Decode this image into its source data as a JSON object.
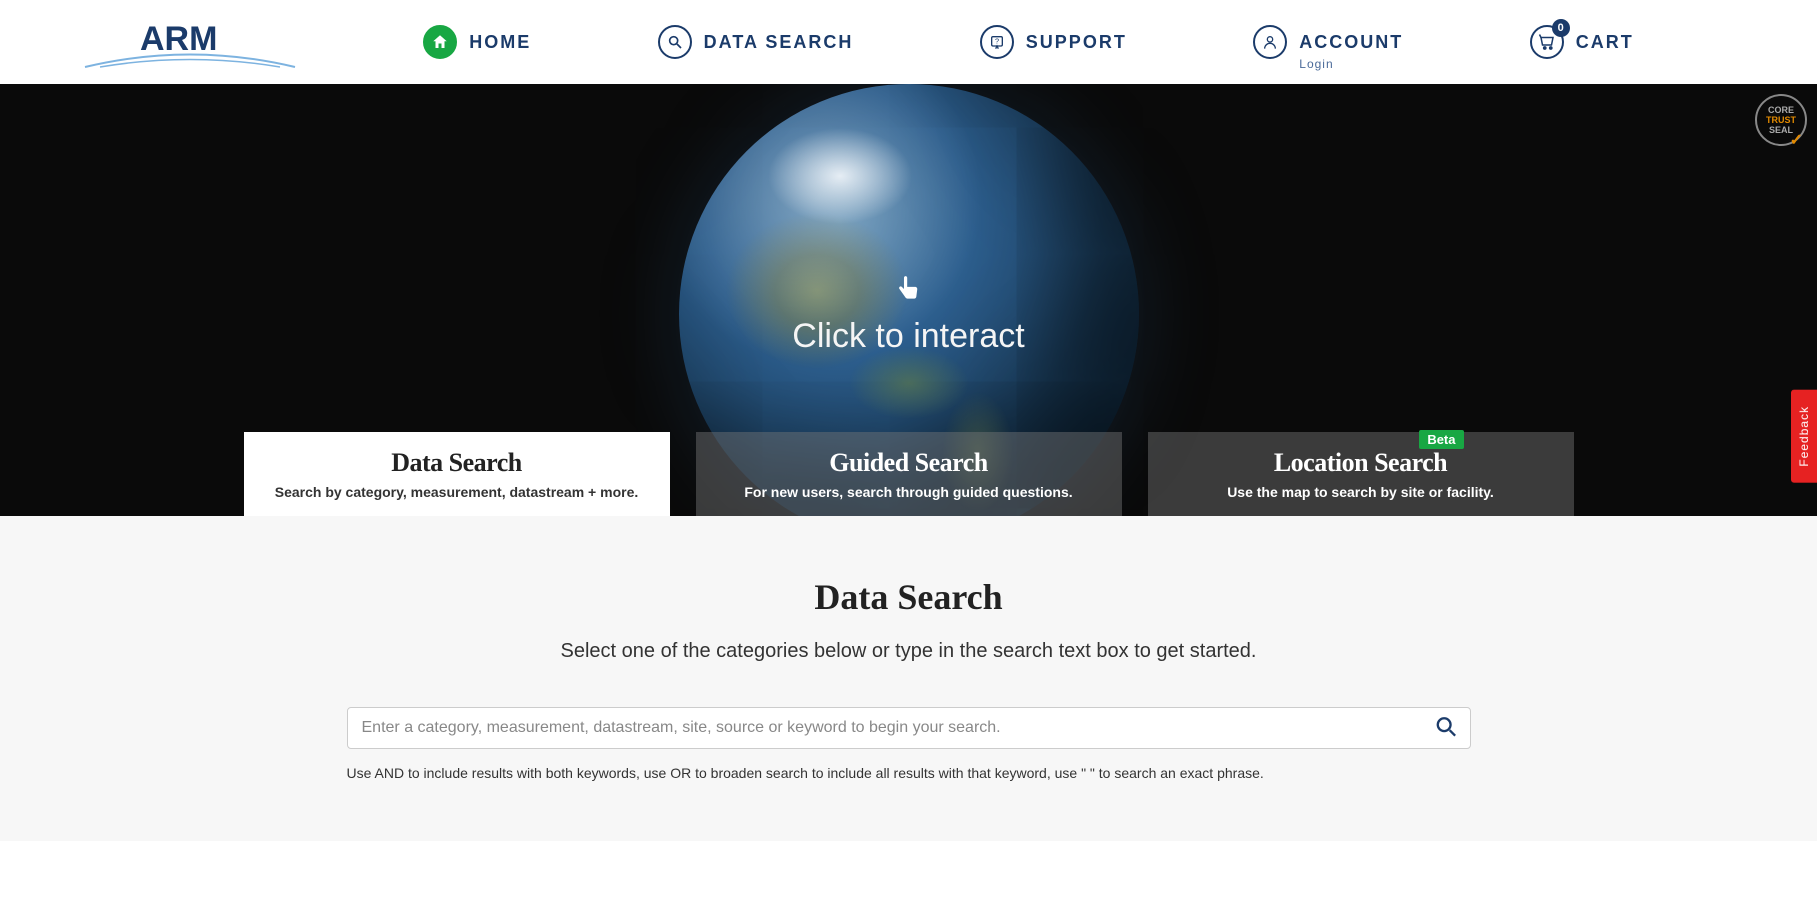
{
  "nav": {
    "home": "HOME",
    "data_search": "DATA SEARCH",
    "support": "SUPPORT",
    "account": "ACCOUNT",
    "account_sub": "Login",
    "cart": "CART",
    "cart_count": "0"
  },
  "hero": {
    "interact": "Click to interact",
    "trust": {
      "line1": "CORE",
      "line2": "TRUST",
      "line3": "SEAL"
    }
  },
  "tabs": [
    {
      "title": "Data Search",
      "sub": "Search by category, measurement, datastream + more."
    },
    {
      "title": "Guided Search",
      "sub": "For new users, search through guided questions."
    },
    {
      "title": "Location Search",
      "sub": "Use the map to search by site or facility.",
      "badge": "Beta"
    }
  ],
  "main": {
    "title": "Data Search",
    "sub": "Select one of the categories below or type in the search text box to get started.",
    "placeholder": "Enter a category, measurement, datastream, site, source or keyword to begin your search.",
    "hint": "Use AND to include results with both keywords, use OR to broaden search to include all results with that keyword, use \" \" to search an exact phrase."
  },
  "feedback": "Feedback"
}
